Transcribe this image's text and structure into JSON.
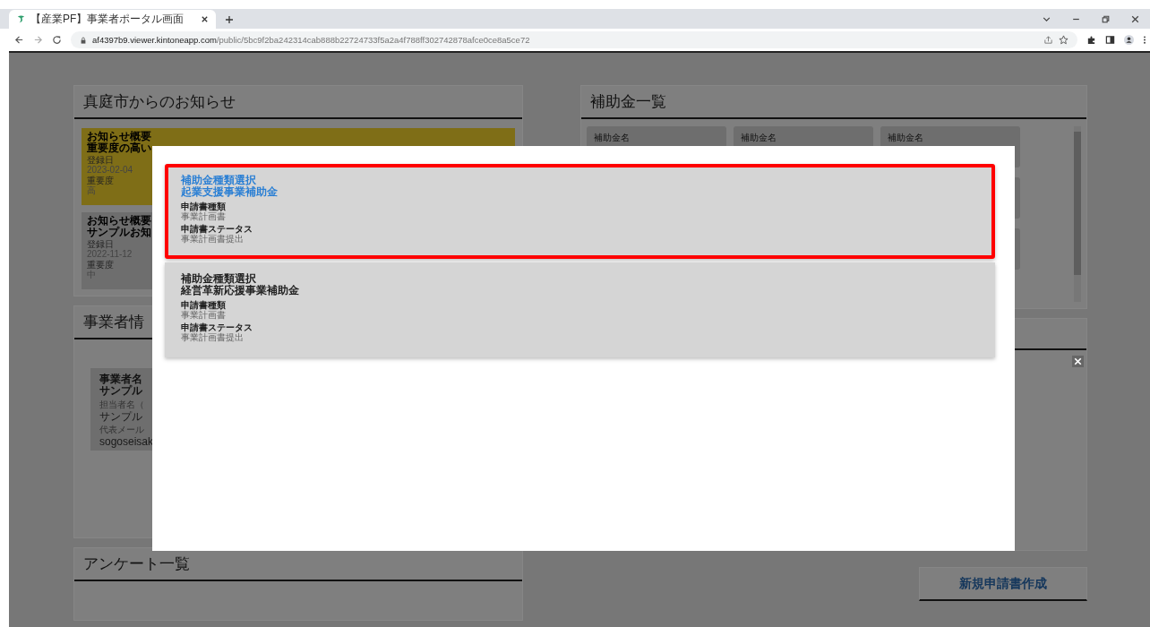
{
  "browser": {
    "tab_title": "【産業PF】事業者ポータル画面",
    "url_host": "af4397b9.viewer.kintoneapp.com",
    "url_path": "/public/5bc9f2ba242314cab888b22724733f5a2a4f788ff302742878afce0ce8a5ce72"
  },
  "notices_panel": {
    "title": "真庭市からのお知らせ",
    "items": [
      {
        "lines": [
          "お知らせ概要",
          "重要度の高い"
        ],
        "date_label": "登録日",
        "date": "2023-02-04",
        "importance_label": "重要度",
        "importance": "高",
        "color": "#7f6e17"
      },
      {
        "lines": [
          "お知らせ概要",
          "サンプルお知"
        ],
        "date_label": "登録日",
        "date": "2022-11-12",
        "importance_label": "重要度",
        "importance": "中",
        "color": "#6e6e6e"
      }
    ]
  },
  "subsidy_panel": {
    "title": "補助金一覧",
    "cards": [
      {
        "label": "補助金名"
      },
      {
        "label": "補助金名"
      },
      {
        "label": "補助金名"
      }
    ]
  },
  "business_panel": {
    "title": "事業者情",
    "card": {
      "name_label": "事業者名",
      "name": "サンプル",
      "contact_label": "担当者名（",
      "contact": "サンプル",
      "email_label": "代表メール",
      "email": "sogoseisak"
    }
  },
  "survey_panel": {
    "title": "アンケート一覧"
  },
  "new_application_button": "新規申請書作成",
  "modal": {
    "items": [
      {
        "selected": true,
        "heading": "補助金種類選択",
        "subsidy": "起業支援事業補助金",
        "type_label": "申請書種類",
        "type": "事業計画書",
        "status_label": "申請書ステータス",
        "status": "事業計画書提出"
      },
      {
        "selected": false,
        "heading": "補助金種類選択",
        "subsidy": "経営革新応援事業補助金",
        "type_label": "申請書種類",
        "type": "事業計画書",
        "status_label": "申請書ステータス",
        "status": "事業計画書提出"
      }
    ]
  }
}
